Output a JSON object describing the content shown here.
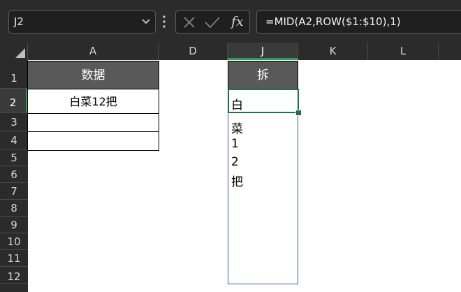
{
  "toolbar": {
    "name_box": "J2",
    "fx_label": "fx",
    "formula": "=MID(A2,ROW($1:$10),1)"
  },
  "columns": [
    "A",
    "D",
    "J",
    "K",
    "L"
  ],
  "rows": [
    "1",
    "2",
    "3",
    "4",
    "5",
    "6",
    "7",
    "8",
    "9",
    "10",
    "11",
    "12"
  ],
  "sheet": {
    "a1": "数据",
    "a2": "白菜12把",
    "j1": "拆",
    "j_values": [
      "白",
      "菜",
      "1",
      "2",
      "把"
    ]
  },
  "colors": {
    "header_fill": "#595959",
    "selection_green": "#1e7145",
    "ui_dark": "#2b2b2b"
  }
}
